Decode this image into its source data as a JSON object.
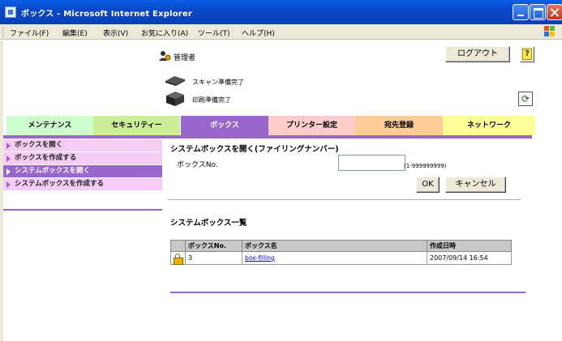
{
  "window": {
    "title": "ボックス - Microsoft Internet Explorer"
  },
  "menubar": {
    "items": [
      "ファイル(F)",
      "編集(E)",
      "表示(V)",
      "お気に入り(A)",
      "ツール(T)",
      "ヘルプ(H)"
    ]
  },
  "header": {
    "user_label": "管理者",
    "logout_label": "ログアウト",
    "help_label": "?",
    "scan_status": "スキャン準備完了",
    "print_status": "印刷準備完了",
    "refresh_icon": "refresh-icon"
  },
  "tabs": [
    {
      "label": "メンテナンス",
      "color": "#ccffcc",
      "active": false
    },
    {
      "label": "セキュリティー",
      "color": "#ccee99",
      "active": false
    },
    {
      "label": "ボックス",
      "color": "#9966cc",
      "active": true
    },
    {
      "label": "プリンター設定",
      "color": "#ffcccc",
      "active": false
    },
    {
      "label": "宛先登録",
      "color": "#ffcc99",
      "active": false
    },
    {
      "label": "ネットワーク",
      "color": "#ffff99",
      "active": false
    }
  ],
  "sidebar": {
    "items": [
      {
        "label": "ボックスを開く",
        "active": false
      },
      {
        "label": "ボックスを作成する",
        "active": false
      },
      {
        "label": "システムボックスを開く",
        "active": true
      },
      {
        "label": "システムボックスを作成する",
        "active": false
      }
    ]
  },
  "open_system_box": {
    "title": "システムボックスを開く(ファイリングナンバー)",
    "box_no_label": "ボックスNo.",
    "box_no_value": "",
    "box_no_range": "(1-999999999)",
    "ok_label": "OK",
    "cancel_label": "キャンセル"
  },
  "system_box_list": {
    "title": "システムボックス一覧",
    "columns": [
      "",
      "ボックスNo.",
      "ボックス名",
      "作成日時"
    ],
    "rows": [
      {
        "locked": true,
        "box_no": "3",
        "box_name": "box-filling",
        "created": "2007/09/14 16:54"
      }
    ]
  },
  "colors": {
    "accent": "#9966cc",
    "sidebar_bg": "#f5ccf5"
  }
}
